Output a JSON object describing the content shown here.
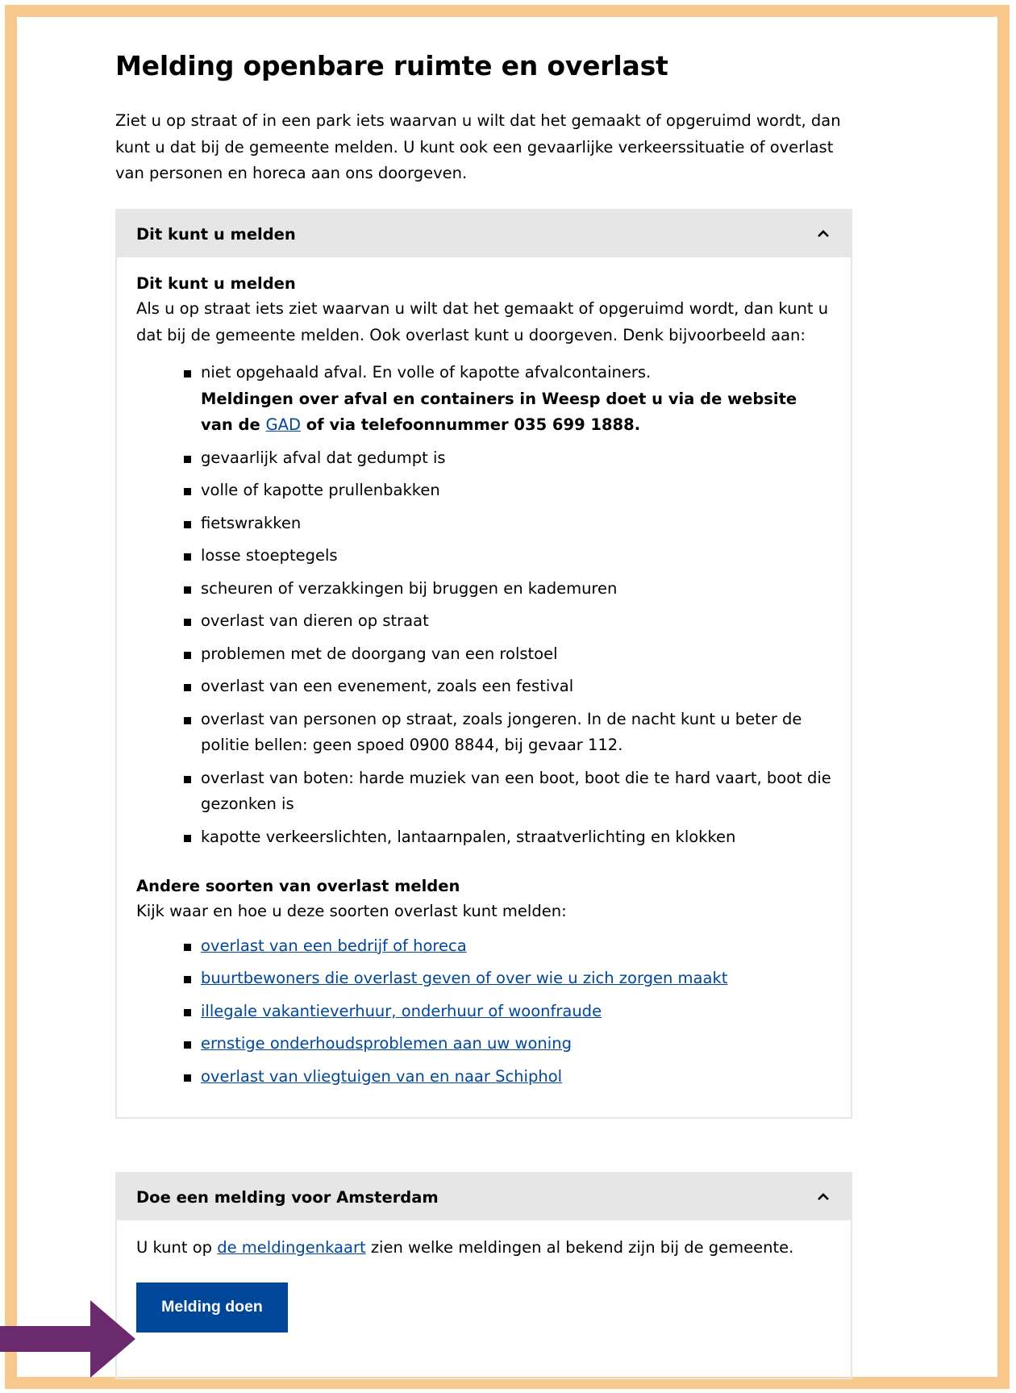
{
  "page": {
    "title": "Melding openbare ruimte en overlast",
    "intro": "Ziet u op straat of in een park iets waarvan u wilt dat het gemaakt of opgeruimd wordt, dan kunt u dat bij de gemeente melden. U kunt ook een gevaarlijke verkeerssituatie of overlast van personen en horeca aan ons doorgeven."
  },
  "accordion1": {
    "header": "Dit kunt u melden",
    "section_title": "Dit kunt u melden",
    "section_text": "Als u op straat iets ziet waarvan u wilt dat het gemaakt of opgeruimd wordt, dan kunt u dat bij de gemeente melden. Ook overlast kunt u doorgeven. Denk bijvoorbeeld aan:",
    "first_item": {
      "text": "niet opgehaald afval. En volle of kapotte afvalcontainers.",
      "note_prefix": "Meldingen over afval en containers in Weesp doet u via de website van de ",
      "note_link": "GAD",
      "note_suffix": " of via telefoonnummer 035 699 1888."
    },
    "items": [
      "gevaarlijk afval dat gedumpt is",
      "volle of kapotte prullenbakken",
      "fietswrakken",
      "losse stoeptegels",
      "scheuren of verzakkingen bij bruggen en kademuren",
      "overlast van dieren op straat",
      "problemen met de doorgang van een rolstoel",
      "overlast van een evenement, zoals een festival",
      "overlast van personen op straat, zoals jongeren. In de nacht kunt u beter de politie bellen: geen spoed 0900 8844, bij gevaar 112.",
      "overlast van boten: harde muziek van een boot, boot die te hard vaart, boot die gezonken is",
      "kapotte verkeerslichten, lantaarnpalen, straatverlichting en klokken"
    ],
    "other_title": "Andere soorten van overlast melden",
    "other_text": "Kijk waar en hoe u deze soorten overlast kunt melden:",
    "links": [
      "overlast van een bedrijf of horeca",
      "buurtbewoners die overlast geven of over wie u zich zorgen maakt",
      "illegale vakantieverhuur, onderhuur of woonfraude",
      "ernstige onderhoudsproblemen aan uw woning",
      "overlast van vliegtuigen van en naar Schiphol"
    ]
  },
  "accordion2": {
    "header": "Doe een melding voor Amsterdam",
    "text_prefix": "U kunt op ",
    "link": "de meldingenkaart",
    "text_suffix": " zien welke meldingen al bekend zijn bij de gemeente.",
    "button": "Melding doen"
  },
  "colors": {
    "frame": "#f7c98c",
    "accordion_header": "#e6e6e6",
    "link": "#004699",
    "button": "#004699",
    "arrow": "#6b2a6e"
  },
  "icons": {
    "accordion_toggle": "chevron-up-icon",
    "annotation": "arrow-right-icon"
  }
}
